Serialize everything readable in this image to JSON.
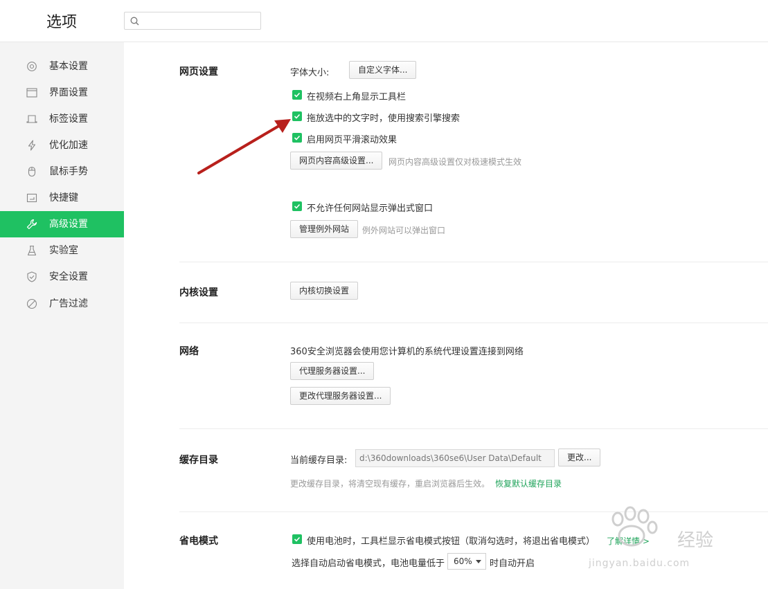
{
  "app": {
    "title": "选项"
  },
  "search": {
    "placeholder": ""
  },
  "sidebar": {
    "items": [
      {
        "label": "基本设置",
        "icon": "gear-icon"
      },
      {
        "label": "界面设置",
        "icon": "window-icon"
      },
      {
        "label": "标签设置",
        "icon": "tab-icon"
      },
      {
        "label": "优化加速",
        "icon": "lightning-icon"
      },
      {
        "label": "鼠标手势",
        "icon": "mouse-icon"
      },
      {
        "label": "快捷键",
        "icon": "keyboard-icon"
      },
      {
        "label": "高级设置",
        "icon": "wrench-icon",
        "active": true
      },
      {
        "label": "实验室",
        "icon": "flask-icon"
      },
      {
        "label": "安全设置",
        "icon": "shield-icon"
      },
      {
        "label": "广告过滤",
        "icon": "block-icon"
      }
    ]
  },
  "webpage": {
    "title": "网页设置",
    "font_size_label": "字体大小:",
    "custom_font_button": "自定义字体...",
    "checkbox_toolbar": "在视频右上角显示工具栏",
    "checkbox_drag_search": "拖放选中的文字时，使用搜索引擎搜索",
    "checkbox_smooth_scroll": "启用网页平滑滚动效果",
    "advanced_content_button": "网页内容高级设置...",
    "advanced_content_hint": "网页内容高级设置仅对极速模式生效",
    "checkbox_block_popups": "不允许任何网站显示弹出式窗口",
    "manage_exceptions_button": "管理例外网站",
    "manage_exceptions_hint": "例外网站可以弹出窗口"
  },
  "kernel": {
    "title": "内核设置",
    "switch_button": "内核切换设置"
  },
  "network": {
    "title": "网络",
    "description": "360安全浏览器会使用您计算机的系统代理设置连接到网络",
    "proxy_button": "代理服务器设置...",
    "change_proxy_button": "更改代理服务器设置..."
  },
  "cache": {
    "title": "缓存目录",
    "current_label": "当前缓存目录:",
    "path_value": "d:\\360downloads\\360se6\\User Data\\Default",
    "change_button": "更改...",
    "hint": "更改缓存目录，将清空现有缓存，重启浏览器后生效。",
    "restore_link": "恢复默认缓存目录"
  },
  "power": {
    "title": "省电模式",
    "checkbox_battery": "使用电池时，工具栏显示省电模式按钮（取消勾选时，将退出省电模式）",
    "learn_more": "了解详情 >",
    "auto_label_prefix": "选择自动启动省电模式，电池电量低于",
    "threshold_value": "60%",
    "auto_label_suffix": "时自动开启"
  },
  "watermark": {
    "brand": "经验",
    "url": "jingyan.baidu.com"
  },
  "colors": {
    "accent": "#1fc162",
    "sidebar_bg": "#f4f4f4",
    "annotation_arrow": "#b8201c"
  }
}
